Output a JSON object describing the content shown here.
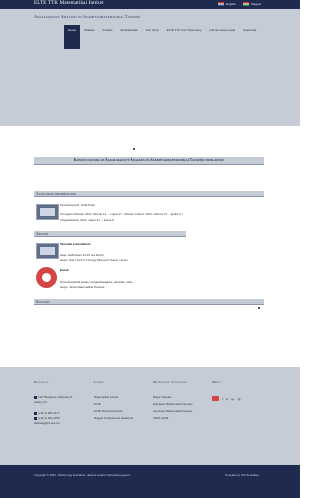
{
  "header": {
    "brand": "ELTE TTK Matematikai Intézet",
    "languages": [
      {
        "label": "English"
      },
      {
        "label": "Magyar"
      }
    ]
  },
  "hero": {
    "subtitle": "Alkalmazott Analízis és Számításmatematikai Tanszék",
    "nav": [
      {
        "label": "Home"
      },
      {
        "label": "Oktatás"
      },
      {
        "label": "Kutatás"
      },
      {
        "label": "Munkatársak"
      },
      {
        "label": "Kari hírek"
      },
      {
        "label": "ELTE TTK Kari Tudomány"
      },
      {
        "label": "Intézeti események"
      },
      {
        "label": "Kapcsolat"
      }
    ]
  },
  "main": {
    "center_title": "Konzultációk az Alkalmazott Analízis és Számításmatematikai Tanszék honlapján",
    "section1_head": "Általános információk",
    "s1_line1": "Tanszékvezető: Izsák Péter",
    "s1_line2": "Szorgalmi időszak: 2024. február 12. – május 17. (Tavaszi szünet: 2024. március 27. - április 2.)",
    "s1_line3": "Vizsgaidőszak: 2024. május 21. – június 5.",
    "section2_head": "Aktivit",
    "s2_title": "Tanszéki szeminárium",
    "s2_line1": "Ideje: Hétfőnként 14-15 óra között",
    "s2_line2": "Helye: D4é Tömb 3-713-ügy Microsoft Teams / Zoom",
    "s3_title": "Esnek",
    "s3_line1": "Numerikuséridő kutató, közgazdaságtani, parciális, fúrás.",
    "s3_line2": "Helye: János Matematikai Tanszék",
    "section3_head": "Kutatás"
  },
  "footer": {
    "col1_head": "Kapcsolat",
    "col1_line1": "1117 Budapest, Pázmány P.",
    "col1_line2": "sétány 1/C",
    "col1_line3": "(+36 1) 381-2177",
    "col1_line4": "(+36 1) 381-2158",
    "col1_line5": "titkarsag@cs.elte.hu",
    "col2_head": "Linkek",
    "col2_links": [
      "Matematikai Intézet",
      "ELTE",
      "ELTE Rényi Központok",
      "Magyar Tudományos Akadémia"
    ],
    "col3_head": "Matematikai Társulatok",
    "col3_links": [
      "Bolyai Társulat",
      "European Mathematical Society",
      "American Mathematical Society",
      "SIAM, EAMI"
    ],
    "col4_head": "Média",
    "social": [
      {
        "label": "f"
      },
      {
        "label": "in"
      },
      {
        "label": "g+"
      },
      {
        "label": "@"
      }
    ]
  },
  "bottom": {
    "copyright": "Copyright © 2024 - Minden jog fenntartva - Eötvös Loránd Tudományegyetem",
    "credit": "Template by CSI Templates"
  },
  "colors": {
    "navy": "#1f2a4f",
    "panel": "#c6ccd6",
    "accent_red": "#d64545"
  }
}
